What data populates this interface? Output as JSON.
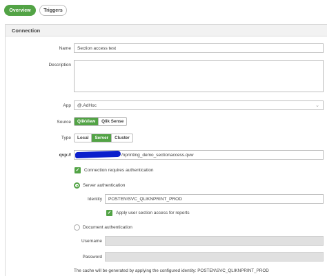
{
  "tabs": [
    {
      "label": "Overview",
      "active": true
    },
    {
      "label": "Triggers",
      "active": false
    }
  ],
  "panel": {
    "title": "Connection"
  },
  "fields": {
    "name_label": "Name",
    "name_value": "Section access test",
    "description_label": "Description",
    "description_value": "",
    "app_label": "App",
    "app_value": "@.AdHoc",
    "source_label": "Source",
    "source_options": [
      "QlikView",
      "Qlik Sense"
    ],
    "source_selected": "QlikView",
    "type_label": "Type",
    "type_options": [
      "Local",
      "Server",
      "Cluster"
    ],
    "type_selected": "Server",
    "qvp_label": "qvp://",
    "qvp_value": "/nprinting_demo_sectionaccess.qvw",
    "requires_auth_label": "Connection requires authentication",
    "server_auth_label": "Server authentication",
    "identity_label": "Identity",
    "identity_value": "POSTEN\\SVC_QLIKNPRINT_PROD",
    "apply_section_label": "Apply user section access for reports",
    "document_auth_label": "Document authentication",
    "username_label": "Username",
    "password_label": "Password",
    "cache_note": "The cache will be generated by applying the configured identity: POSTEN\\SVC_QLIKNPRINT_PROD"
  },
  "colors": {
    "accent": "#52a345",
    "redaction": "#0b1fcc"
  },
  "icons": {
    "dropdown": "chevron-down-icon",
    "check": "checkmark-icon"
  }
}
